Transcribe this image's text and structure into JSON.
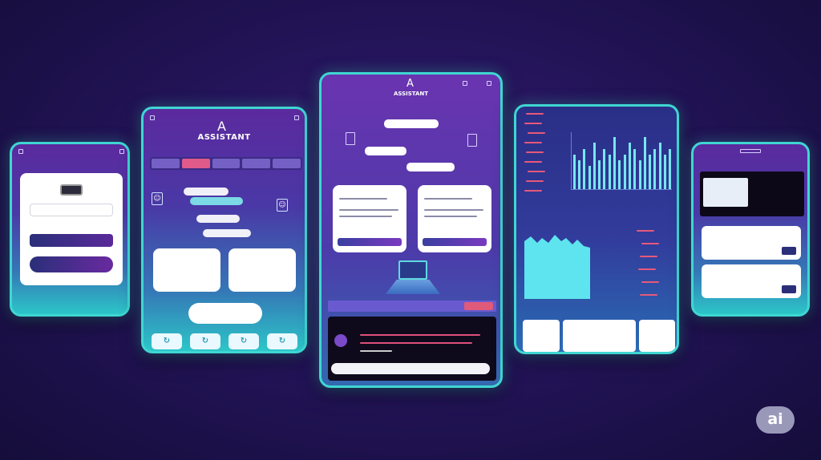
{
  "phone_left": {
    "logo_text": "",
    "field_text": "",
    "primary_button": "",
    "secondary_button": ""
  },
  "phone_second": {
    "title": "ASSISTANT",
    "logo_glyph": "A",
    "tabs": [
      "",
      "",
      "",
      "",
      ""
    ]
  },
  "phone_center": {
    "title": "ASSISTANT",
    "logo_glyph": "A",
    "tag": "",
    "black_heading": ""
  },
  "phone_chart": {
    "chart_data": {
      "type": "bar",
      "values": [
        6,
        5,
        7,
        4,
        8,
        5,
        7,
        6,
        9,
        5,
        6,
        8,
        7,
        5,
        9,
        6,
        7,
        8,
        6,
        7
      ]
    }
  },
  "phone_right": {},
  "badge": {
    "text": "ai"
  },
  "colors": {
    "accent": "#3fd6d2",
    "background": "#24145a",
    "pink": "#e05a8a",
    "cyan": "#78e6f0"
  },
  "icons": [
    "a-logo-icon",
    "robot-icon",
    "laptop-icon",
    "refresh-icon"
  ]
}
